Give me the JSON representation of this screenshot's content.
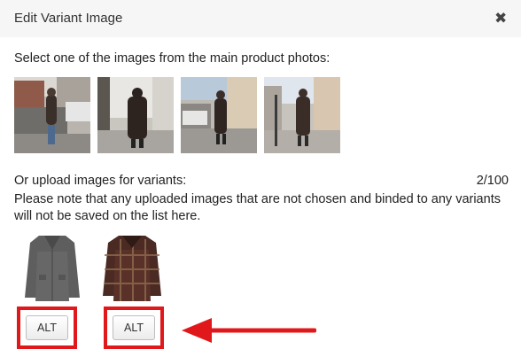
{
  "header": {
    "title": "Edit Variant Image",
    "close_icon": "close-x-icon"
  },
  "main_photos": {
    "prompt": "Select one of the images from the main product photos:",
    "images": [
      {
        "alt": "street photo 1"
      },
      {
        "alt": "street photo 2"
      },
      {
        "alt": "street photo 3"
      },
      {
        "alt": "street photo 4"
      }
    ]
  },
  "uploads": {
    "prompt": "Or upload images for variants:",
    "count": "2/100",
    "note_line1": "Please note that any uploaded images that are not chosen and binded to any variants",
    "note_line2": "will not be saved on the list here.",
    "items": [
      {
        "button_label": "ALT",
        "image": "grey coat"
      },
      {
        "button_label": "ALT",
        "image": "plaid coat"
      }
    ]
  },
  "colors": {
    "highlight": "#e0181b",
    "header_bg": "#f6f6f6"
  }
}
